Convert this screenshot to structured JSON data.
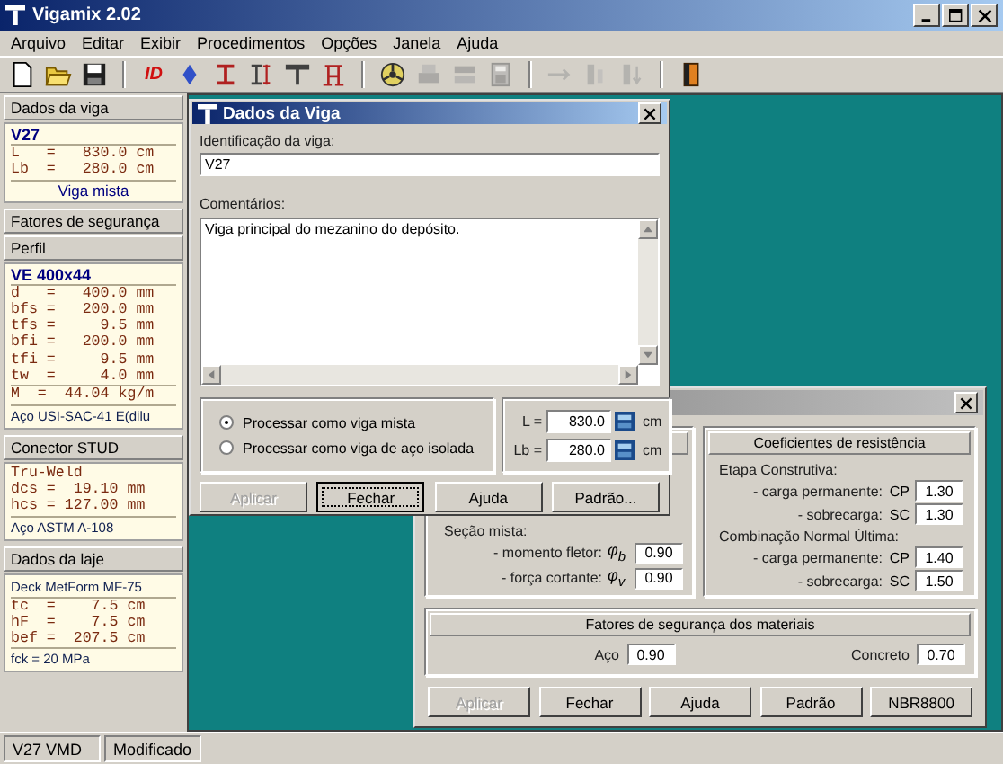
{
  "window": {
    "title": "Vigamix 2.02"
  },
  "menu": [
    "Arquivo",
    "Editar",
    "Exibir",
    "Procedimentos",
    "Opções",
    "Janela",
    "Ajuda"
  ],
  "toolbar": {
    "groups": [
      [
        {
          "kind": "new",
          "disabled": false
        },
        {
          "kind": "open",
          "disabled": false
        },
        {
          "kind": "save",
          "disabled": false
        }
      ],
      [
        {
          "kind": "id",
          "label": "ID",
          "disabled": false
        },
        {
          "kind": "diamond",
          "disabled": false
        },
        {
          "kind": "ibeam",
          "disabled": false
        },
        {
          "kind": "ibeam-dims",
          "disabled": false
        },
        {
          "kind": "tbeam",
          "disabled": false
        },
        {
          "kind": "truss",
          "disabled": false
        }
      ],
      [
        {
          "kind": "wheel",
          "disabled": false
        },
        {
          "kind": "printer",
          "disabled": true
        },
        {
          "kind": "slab",
          "disabled": true
        },
        {
          "kind": "calculator",
          "disabled": true
        }
      ],
      [
        {
          "kind": "arrow",
          "disabled": true
        },
        {
          "kind": "bars",
          "disabled": true
        },
        {
          "kind": "bars-down",
          "disabled": true
        }
      ],
      [
        {
          "kind": "door",
          "disabled": false
        }
      ]
    ]
  },
  "info_panel": {
    "sections": [
      {
        "header": "Dados da viga",
        "blocks": [
          {
            "kind": "title",
            "text": "V27"
          },
          {
            "kind": "mono",
            "lines": [
              "L   =   830.0 cm",
              "Lb  =   280.0 cm"
            ]
          },
          {
            "kind": "caption",
            "text": "Viga mista"
          }
        ]
      },
      {
        "header": "Fatores de segurança"
      },
      {
        "header": "Perfil",
        "blocks": [
          {
            "kind": "title",
            "text": "VE 400x44"
          },
          {
            "kind": "mono",
            "lines": [
              "d   =   400.0 mm",
              "bfs =   200.0 mm",
              "tfs =     9.5 mm",
              "bfi =   200.0 mm",
              "tfi =     9.5 mm",
              "tw  =     4.0 mm"
            ]
          },
          {
            "kind": "mono",
            "lines": [
              "M  =  44.04 kg/m"
            ]
          },
          {
            "kind": "note",
            "text": "Aço USI-SAC-41 E(dilu"
          }
        ]
      },
      {
        "header": "Conector STUD",
        "blocks": [
          {
            "kind": "mono",
            "lines": [
              "Tru-Weld",
              "dcs =  19.10 mm",
              "hcs = 127.00 mm"
            ]
          },
          {
            "kind": "note",
            "text": "Aço ASTM A-108"
          }
        ]
      },
      {
        "header": "Dados da laje",
        "blocks": [
          {
            "kind": "note",
            "text": "Deck MetForm MF-75"
          },
          {
            "kind": "mono",
            "lines": [
              "tc  =    7.5 cm",
              "hF  =    7.5 cm",
              "bef =  207.5 cm"
            ]
          },
          {
            "kind": "note",
            "text": "fck = 20 MPa"
          }
        ]
      }
    ]
  },
  "beam_dialog": {
    "title": "Dados da Viga",
    "id_label": "Identificação da viga:",
    "id_value": "V27",
    "comments_label": "Comentários:",
    "comments_value": "Viga principal do mezanino do depósito.",
    "options": [
      {
        "label": "Processar como viga mista",
        "selected": true
      },
      {
        "label": "Processar como viga de aço isolada",
        "selected": false
      }
    ],
    "lengths": [
      {
        "label": "L =",
        "value": "830.0",
        "unit": "cm"
      },
      {
        "label": "Lb =",
        "value": "280.0",
        "unit": "cm"
      }
    ],
    "buttons": [
      {
        "label": "Aplicar",
        "disabled": true,
        "focused": false
      },
      {
        "label": "Fechar",
        "disabled": false,
        "focused": true
      },
      {
        "label": "Ajuda",
        "disabled": false,
        "focused": false
      },
      {
        "label": "Padrão...",
        "disabled": false,
        "focused": false
      }
    ]
  },
  "safety_dialog": {
    "composite": {
      "heading": "Seção mista:",
      "rows": [
        {
          "label": "- momento fletor:",
          "symbol": "φ$_{b}$",
          "value": "0.90"
        },
        {
          "label": "- força cortante:",
          "symbol": "φ$_{v}$",
          "value": "0.90"
        }
      ]
    },
    "resistance": {
      "header": "Coeficientes de resistência",
      "groups": [
        {
          "heading": "Etapa Construtiva:",
          "rows": [
            {
              "label": "- carga permanente:",
              "code": "CP",
              "value": "1.30"
            },
            {
              "label": "- sobrecarga:",
              "code": "SC",
              "value": "1.30"
            }
          ]
        },
        {
          "heading": "Combinação Normal Última:",
          "rows": [
            {
              "label": "- carga permanente:",
              "code": "CP",
              "value": "1.40"
            },
            {
              "label": "- sobrecarga:",
              "code": "SC",
              "value": "1.50"
            }
          ]
        }
      ]
    },
    "materials": {
      "header": "Fatores de segurança dos materiais",
      "fields": [
        {
          "label": "Aço",
          "value": "0.90"
        },
        {
          "label": "Concreto",
          "value": "0.70"
        }
      ]
    },
    "buttons": [
      {
        "label": "Aplicar",
        "disabled": true
      },
      {
        "label": "Fechar",
        "disabled": false
      },
      {
        "label": "Ajuda",
        "disabled": false
      },
      {
        "label": "Padrão",
        "disabled": false
      },
      {
        "label": "NBR8800",
        "disabled": false
      }
    ]
  },
  "status_bar": [
    "V27 VMD",
    "Modificado"
  ]
}
